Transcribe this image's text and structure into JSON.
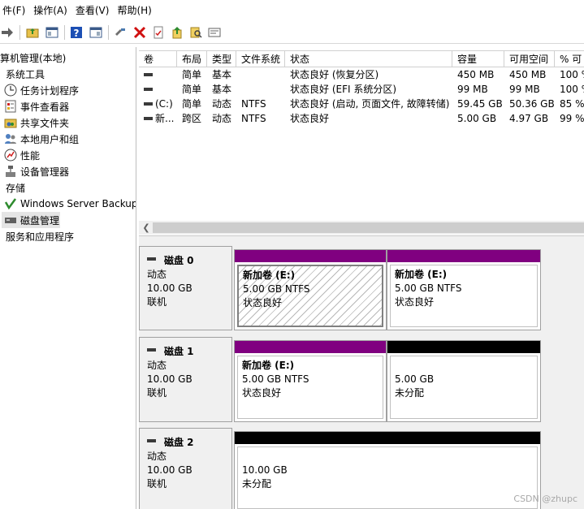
{
  "menubar": {
    "items": [
      "件(F)",
      "操作(A)",
      "查看(V)",
      "帮助(H)"
    ]
  },
  "toolbar": {
    "icons": [
      "forward-arrow-icon",
      "up-folder-icon",
      "show-hide-tree-icon",
      "help-icon",
      "console-icon",
      "connect-icon",
      "delete-icon",
      "properties-icon",
      "export-icon",
      "search-icon",
      "rescan-icon"
    ]
  },
  "tree": {
    "items": [
      {
        "label": "算机管理(本地)"
      },
      {
        "label": "系统工具"
      },
      {
        "label": "任务计划程序"
      },
      {
        "label": "事件查看器"
      },
      {
        "label": "共享文件夹"
      },
      {
        "label": "本地用户和组"
      },
      {
        "label": "性能"
      },
      {
        "label": "设备管理器"
      },
      {
        "label": "存储"
      },
      {
        "label": "Windows Server Backup"
      },
      {
        "label": "磁盘管理"
      },
      {
        "label": "服务和应用程序"
      }
    ]
  },
  "volume_list": {
    "columns": [
      "卷",
      "布局",
      "类型",
      "文件系统",
      "状态",
      "容量",
      "可用空间",
      "% 可"
    ],
    "rows": [
      {
        "vol": "",
        "layout": "简单",
        "type": "基本",
        "fs": "",
        "status": "状态良好 (恢复分区)",
        "capacity": "450 MB",
        "free": "450 MB",
        "pct": "100 %"
      },
      {
        "vol": "",
        "layout": "简单",
        "type": "基本",
        "fs": "",
        "status": "状态良好 (EFI 系统分区)",
        "capacity": "99 MB",
        "free": "99 MB",
        "pct": "100 %"
      },
      {
        "vol": "(C:)",
        "layout": "简单",
        "type": "动态",
        "fs": "NTFS",
        "status": "状态良好 (启动, 页面文件, 故障转储)",
        "capacity": "59.45 GB",
        "free": "50.36 GB",
        "pct": "85 %"
      },
      {
        "vol": "新...",
        "layout": "跨区",
        "type": "动态",
        "fs": "NTFS",
        "status": "状态良好",
        "capacity": "5.00 GB",
        "free": "4.97 GB",
        "pct": "99 %"
      }
    ]
  },
  "disks": [
    {
      "name": "磁盘 0",
      "type": "动态",
      "size": "10.00 GB",
      "state": "联机",
      "partitions": [
        {
          "title": "新加卷  (E:)",
          "size": "5.00 GB NTFS",
          "status": "状态良好",
          "bar_color": "#800080",
          "selected": true
        },
        {
          "title": "新加卷  (E:)",
          "size": "5.00 GB NTFS",
          "status": "状态良好",
          "bar_color": "#800080",
          "selected": false
        }
      ]
    },
    {
      "name": "磁盘 1",
      "type": "动态",
      "size": "10.00 GB",
      "state": "联机",
      "partitions": [
        {
          "title": "新加卷  (E:)",
          "size": "5.00 GB NTFS",
          "status": "状态良好",
          "bar_color": "#800080"
        },
        {
          "size": "5.00 GB",
          "status": "未分配",
          "bar_color": "#000000"
        }
      ]
    },
    {
      "name": "磁盘 2",
      "type": "动态",
      "size": "10.00 GB",
      "state": "联机",
      "partitions": [
        {
          "size": "10.00 GB",
          "status": "未分配",
          "bar_color": "#000000"
        }
      ]
    }
  ],
  "watermark": "CSDN @zhupc"
}
